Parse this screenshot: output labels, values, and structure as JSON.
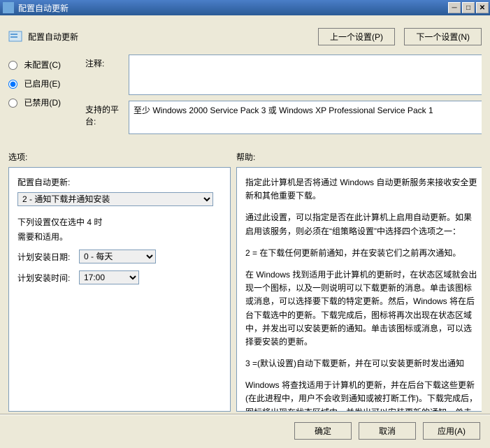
{
  "window": {
    "title": "配置自动更新",
    "page_title": "配置自动更新",
    "prev_setting": "上一个设置(P)",
    "next_setting": "下一个设置(N)"
  },
  "radios": {
    "not_configured": "未配置(C)",
    "enabled": "已启用(E)",
    "disabled": "已禁用(D)",
    "selected": "enabled"
  },
  "fields": {
    "comment_label": "注释:",
    "comment_value": "",
    "platform_label": "支持的平台:",
    "platform_value": "至少 Windows 2000 Service Pack 3 或 Windows XP Professional Service Pack 1"
  },
  "sections": {
    "options_label": "选项:",
    "help_label": "帮助:"
  },
  "options": {
    "config_label": "配置自动更新:",
    "config_selected": "2 - 通知下载并通知安装",
    "note1": "下列设置仅在选中 4 时",
    "note2": "需要和适用。",
    "day_label": "计划安装日期:",
    "day_selected": "0 - 每天",
    "time_label": "计划安装时间:",
    "time_selected": "17:00"
  },
  "help": {
    "p1": "指定此计算机是否将通过 Windows 自动更新服务来接收安全更新和其他重要下载。",
    "p2": "通过此设置，可以指定是否在此计算机上启用自动更新。如果启用该服务，则必须在“组策略设置”中选择四个选项之一：",
    "p3": "2 = 在下载任何更新前通知，并在安装它们之前再次通知。",
    "p4": "在 Windows 找到适用于此计算机的更新时，在状态区域就会出现一个图标，以及一则说明可以下载更新的消息。单击该图标或消息，可以选择要下载的特定更新。然后，Windows 将在后台下载选中的更新。下载完成后，图标将再次出现在状态区域中，并发出可以安装更新的通知。单击该图标或消息，可以选择要安装的更新。",
    "p5": "3 =(默认设置)自动下载更新，并在可以安装更新时发出通知",
    "p6": "Windows 将查找适用于计算机的更新，并在后台下载这些更新(在此进程中，用户不会收到通知或被打断工作)。下载完成后，图标将出现在状态区域中，并发出可以安装更新的通知。单击该图标或"
  },
  "footer": {
    "ok": "确定",
    "cancel": "取消",
    "apply": "应用(A)"
  }
}
